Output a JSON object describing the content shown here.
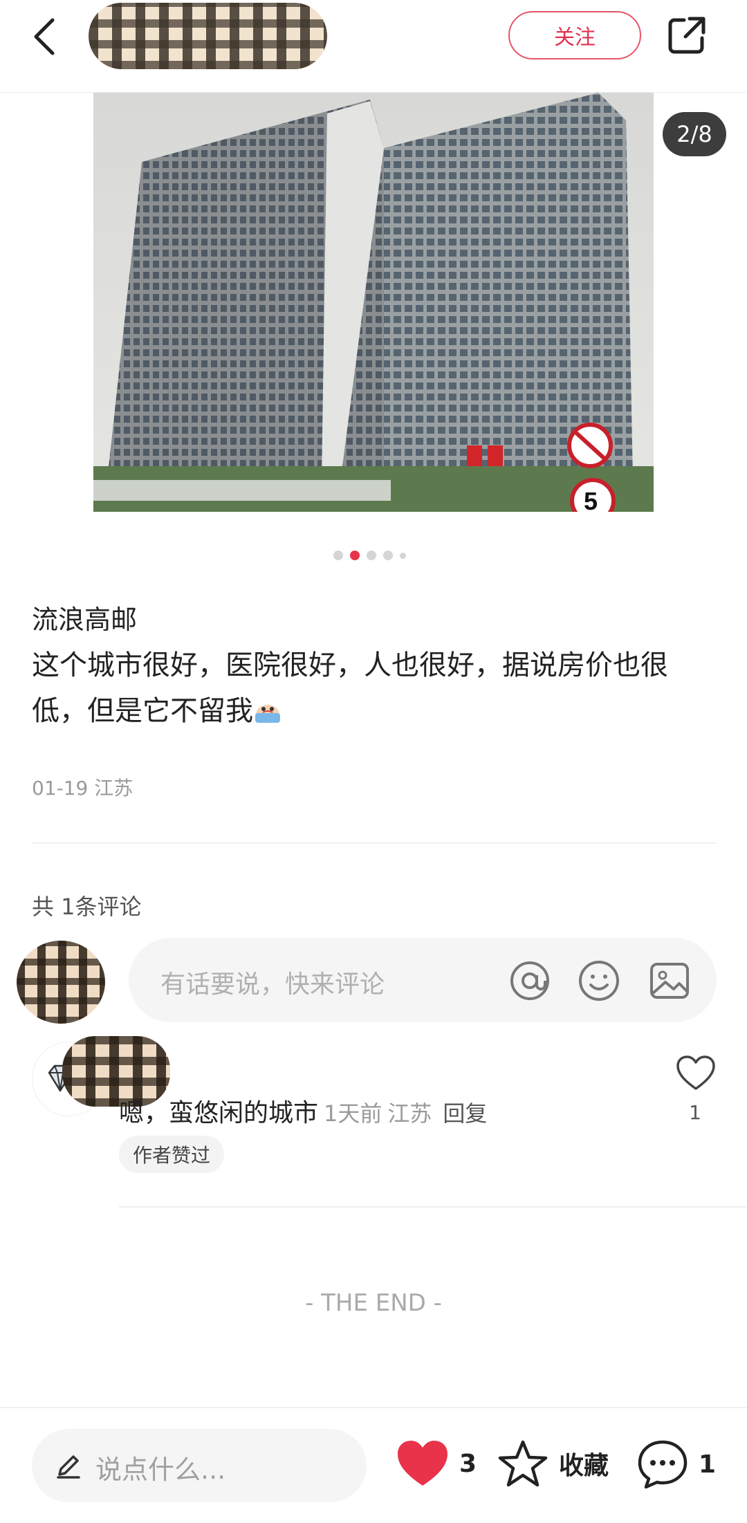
{
  "header": {
    "follow_label": "关注"
  },
  "gallery": {
    "counter": "2/8",
    "dots_total": 5,
    "dots_active_index": 1
  },
  "post": {
    "title": "流浪高邮",
    "body": "这个城市很好，医院很好，人也很好，据说房价也很低，但是它不留我",
    "date": "01-19",
    "location": "江苏"
  },
  "comments": {
    "count_label": "共 1条评论",
    "input_placeholder": "有话要说，快来评论",
    "items": [
      {
        "text": "嗯，蛮悠闲的城市",
        "time": "1天前",
        "location": "江苏",
        "reply_label": "回复",
        "author_liked_tag": "作者赞过",
        "like_count": "1"
      }
    ]
  },
  "end_label": "- THE END -",
  "bottom_bar": {
    "say_placeholder": "说点什么...",
    "like_count": "3",
    "collect_label": "收藏",
    "comment_count": "1"
  },
  "colors": {
    "accent_red": "#e8334a",
    "follow_border": "#e8546a",
    "muted_text": "#9a9a9a"
  },
  "icons": [
    "back-icon",
    "share-icon",
    "at-icon",
    "emoji-icon",
    "image-icon",
    "diamond-icon",
    "heart-outline-icon",
    "pen-icon",
    "heart-filled-icon",
    "star-icon",
    "comment-bubble-icon"
  ]
}
